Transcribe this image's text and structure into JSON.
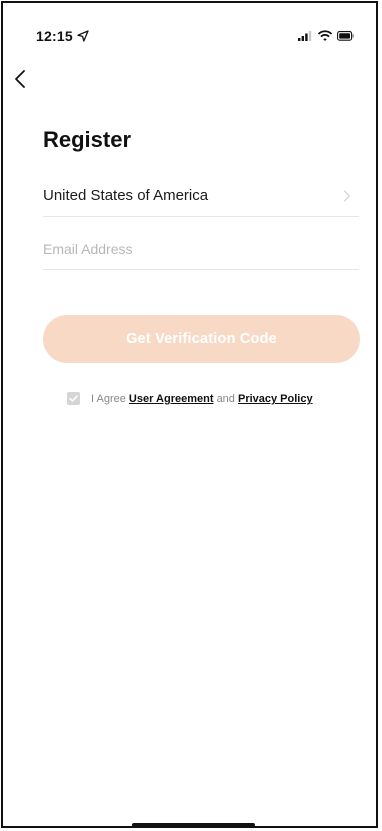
{
  "status_bar": {
    "time": "12:15",
    "icons": [
      "location-arrow-icon",
      "signal-icon",
      "wifi-icon",
      "battery-icon"
    ]
  },
  "nav": {
    "back_icon": "chevron-left-icon"
  },
  "page": {
    "title": "Register"
  },
  "form": {
    "country_value": "United States of America",
    "country_icon": "chevron-right-icon",
    "email_placeholder": "Email Address",
    "email_value": "",
    "submit_label": "Get Verification Code"
  },
  "agreement": {
    "checked": true,
    "prefix": "I Agree",
    "user_agreement_label": "User Agreement",
    "connector": "and",
    "privacy_policy_label": "Privacy Policy"
  },
  "colors": {
    "accent_button_disabled": "#f8d9c5",
    "button_text": "#ffffff",
    "divider": "#e6e6e6",
    "placeholder": "#b7b7b7"
  }
}
